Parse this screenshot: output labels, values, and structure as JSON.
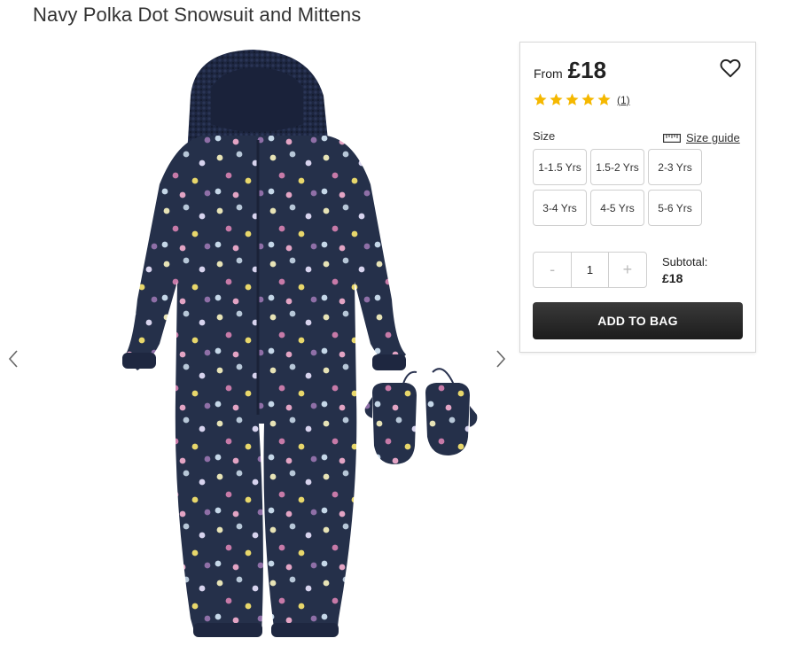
{
  "product": {
    "title": "Navy Polka Dot Snowsuit and Mittens"
  },
  "gallery": {
    "prev_icon": "chevron-left-icon",
    "next_icon": "chevron-right-icon",
    "image_alt": "Navy polka dot snowsuit with mittens"
  },
  "price": {
    "from_label": "From",
    "value": "£18"
  },
  "wishlist": {
    "icon": "heart-outline-icon"
  },
  "rating": {
    "stars": 5,
    "max": 5,
    "count_label": "(1)",
    "star_color": "#f5b800"
  },
  "size": {
    "label": "Size",
    "guide_label": "Size guide",
    "guide_icon": "ruler-icon",
    "options": [
      "1-1.5 Yrs",
      "1.5-2 Yrs",
      "2-3 Yrs",
      "3-4 Yrs",
      "4-5 Yrs",
      "5-6 Yrs"
    ]
  },
  "quantity": {
    "minus_label": "-",
    "value": "1",
    "plus_label": "+"
  },
  "subtotal": {
    "label": "Subtotal:",
    "value": "£18"
  },
  "cta": {
    "add_to_bag_label": "ADD TO BAG"
  }
}
